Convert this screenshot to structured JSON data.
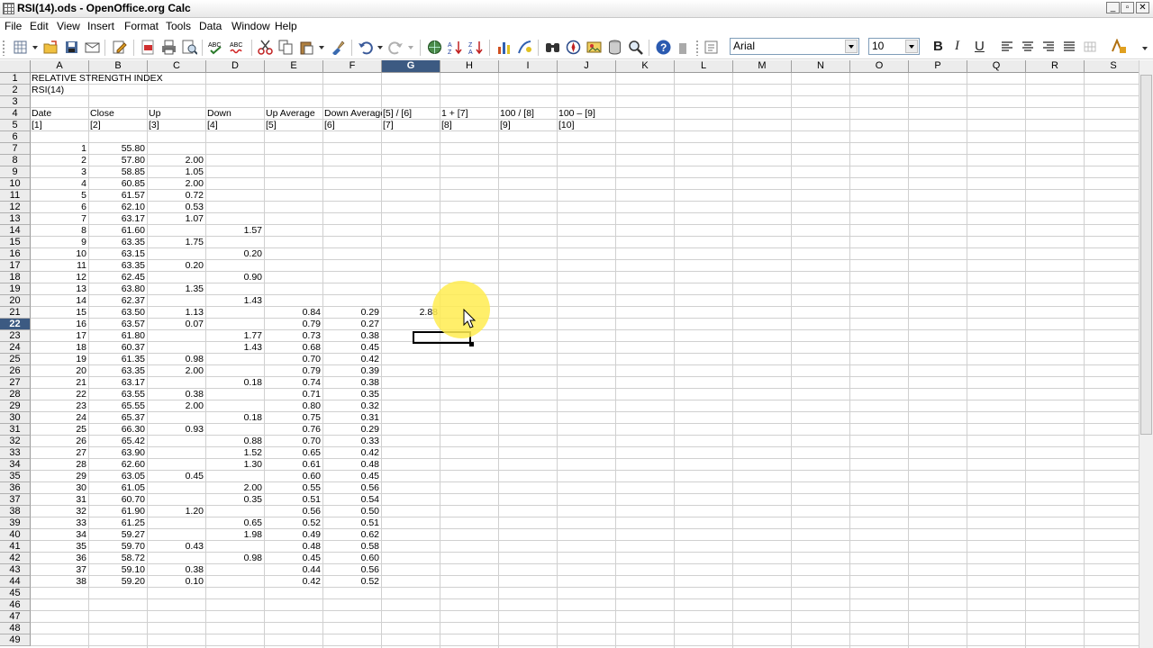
{
  "window": {
    "title": "RSI(14).ods - OpenOffice.org Calc",
    "controls": [
      "_",
      "▫",
      "✕"
    ]
  },
  "menu": [
    "File",
    "Edit",
    "View",
    "Insert",
    "Format",
    "Tools",
    "Data",
    "Window",
    "Help"
  ],
  "toolbar": {
    "font_name": "Arial",
    "font_size": "10",
    "bold": "B",
    "italic": "I",
    "underline": "U",
    "icons": [
      "new-icon",
      "open-icon",
      "save-icon",
      "email-icon",
      "edit-file-icon",
      "export-pdf-icon",
      "print-icon",
      "page-preview-icon",
      "spellcheck-icon",
      "autospell-icon",
      "cut-icon",
      "copy-icon",
      "paste-icon",
      "format-paintbrush-icon",
      "undo-icon",
      "redo-icon",
      "hyperlink-icon",
      "sort-ascending-icon",
      "sort-descending-icon",
      "chart-icon",
      "show-draw-functions-icon",
      "find-icon",
      "navigator-icon",
      "gallery-icon",
      "data-sources-icon",
      "zoom-icon",
      "help-icon"
    ]
  },
  "spreadsheet": {
    "selected_cell": "G22",
    "columns": [
      "A",
      "B",
      "C",
      "D",
      "E",
      "F",
      "G",
      "H",
      "I",
      "J",
      "K",
      "L",
      "M",
      "N",
      "O",
      "P",
      "Q",
      "R",
      "S"
    ],
    "rows": [
      "1",
      "2",
      "3",
      "4",
      "5",
      "6",
      "7",
      "8",
      "9",
      "10",
      "11",
      "12",
      "13",
      "14",
      "15",
      "16",
      "17",
      "18",
      "19",
      "20",
      "21",
      "22",
      "23",
      "24",
      "25",
      "26",
      "27",
      "28",
      "29",
      "30",
      "31",
      "32",
      "33",
      "34",
      "35",
      "36",
      "37",
      "38",
      "39",
      "40",
      "41",
      "42",
      "43",
      "44",
      "45",
      "46",
      "47",
      "48",
      "49"
    ],
    "title_rows": [
      {
        "row": 1,
        "col": 0,
        "text": "RELATIVE STRENGTH INDEX"
      },
      {
        "row": 2,
        "col": 0,
        "text": "RSI(14)"
      }
    ],
    "headers": [
      "Date",
      "Close",
      "Up",
      "Down",
      "Up Average",
      "Down Average",
      "[5] / [6]",
      "1 + [7]",
      "100 / [8]",
      "100 – [9]"
    ],
    "header_refs": [
      "[1]",
      "[2]",
      "[3]",
      "[4]",
      "[5]",
      "[6]",
      "[7]",
      "[8]",
      "[9]",
      "[10]"
    ],
    "data_rows": [
      {
        "date": "1",
        "close": "55.80",
        "up": "",
        "down": "",
        "up_avg": "",
        "down_avg": "",
        "g": ""
      },
      {
        "date": "2",
        "close": "57.80",
        "up": "2.00",
        "down": "",
        "up_avg": "",
        "down_avg": "",
        "g": ""
      },
      {
        "date": "3",
        "close": "58.85",
        "up": "1.05",
        "down": "",
        "up_avg": "",
        "down_avg": "",
        "g": ""
      },
      {
        "date": "4",
        "close": "60.85",
        "up": "2.00",
        "down": "",
        "up_avg": "",
        "down_avg": "",
        "g": ""
      },
      {
        "date": "5",
        "close": "61.57",
        "up": "0.72",
        "down": "",
        "up_avg": "",
        "down_avg": "",
        "g": ""
      },
      {
        "date": "6",
        "close": "62.10",
        "up": "0.53",
        "down": "",
        "up_avg": "",
        "down_avg": "",
        "g": ""
      },
      {
        "date": "7",
        "close": "63.17",
        "up": "1.07",
        "down": "",
        "up_avg": "",
        "down_avg": "",
        "g": ""
      },
      {
        "date": "8",
        "close": "61.60",
        "up": "",
        "down": "1.57",
        "up_avg": "",
        "down_avg": "",
        "g": ""
      },
      {
        "date": "9",
        "close": "63.35",
        "up": "1.75",
        "down": "",
        "up_avg": "",
        "down_avg": "",
        "g": ""
      },
      {
        "date": "10",
        "close": "63.15",
        "up": "",
        "down": "0.20",
        "up_avg": "",
        "down_avg": "",
        "g": ""
      },
      {
        "date": "11",
        "close": "63.35",
        "up": "0.20",
        "down": "",
        "up_avg": "",
        "down_avg": "",
        "g": ""
      },
      {
        "date": "12",
        "close": "62.45",
        "up": "",
        "down": "0.90",
        "up_avg": "",
        "down_avg": "",
        "g": ""
      },
      {
        "date": "13",
        "close": "63.80",
        "up": "1.35",
        "down": "",
        "up_avg": "",
        "down_avg": "",
        "g": ""
      },
      {
        "date": "14",
        "close": "62.37",
        "up": "",
        "down": "1.43",
        "up_avg": "",
        "down_avg": "",
        "g": ""
      },
      {
        "date": "15",
        "close": "63.50",
        "up": "1.13",
        "down": "",
        "up_avg": "0.84",
        "down_avg": "0.29",
        "g": "2.88"
      },
      {
        "date": "16",
        "close": "63.57",
        "up": "0.07",
        "down": "",
        "up_avg": "0.79",
        "down_avg": "0.27",
        "g": ""
      },
      {
        "date": "17",
        "close": "61.80",
        "up": "",
        "down": "1.77",
        "up_avg": "0.73",
        "down_avg": "0.38",
        "g": ""
      },
      {
        "date": "18",
        "close": "60.37",
        "up": "",
        "down": "1.43",
        "up_avg": "0.68",
        "down_avg": "0.45",
        "g": ""
      },
      {
        "date": "19",
        "close": "61.35",
        "up": "0.98",
        "down": "",
        "up_avg": "0.70",
        "down_avg": "0.42",
        "g": ""
      },
      {
        "date": "20",
        "close": "63.35",
        "up": "2.00",
        "down": "",
        "up_avg": "0.79",
        "down_avg": "0.39",
        "g": ""
      },
      {
        "date": "21",
        "close": "63.17",
        "up": "",
        "down": "0.18",
        "up_avg": "0.74",
        "down_avg": "0.38",
        "g": ""
      },
      {
        "date": "22",
        "close": "63.55",
        "up": "0.38",
        "down": "",
        "up_avg": "0.71",
        "down_avg": "0.35",
        "g": ""
      },
      {
        "date": "23",
        "close": "65.55",
        "up": "2.00",
        "down": "",
        "up_avg": "0.80",
        "down_avg": "0.32",
        "g": ""
      },
      {
        "date": "24",
        "close": "65.37",
        "up": "",
        "down": "0.18",
        "up_avg": "0.75",
        "down_avg": "0.31",
        "g": ""
      },
      {
        "date": "25",
        "close": "66.30",
        "up": "0.93",
        "down": "",
        "up_avg": "0.76",
        "down_avg": "0.29",
        "g": ""
      },
      {
        "date": "26",
        "close": "65.42",
        "up": "",
        "down": "0.88",
        "up_avg": "0.70",
        "down_avg": "0.33",
        "g": ""
      },
      {
        "date": "27",
        "close": "63.90",
        "up": "",
        "down": "1.52",
        "up_avg": "0.65",
        "down_avg": "0.42",
        "g": ""
      },
      {
        "date": "28",
        "close": "62.60",
        "up": "",
        "down": "1.30",
        "up_avg": "0.61",
        "down_avg": "0.48",
        "g": ""
      },
      {
        "date": "29",
        "close": "63.05",
        "up": "0.45",
        "down": "",
        "up_avg": "0.60",
        "down_avg": "0.45",
        "g": ""
      },
      {
        "date": "30",
        "close": "61.05",
        "up": "",
        "down": "2.00",
        "up_avg": "0.55",
        "down_avg": "0.56",
        "g": ""
      },
      {
        "date": "31",
        "close": "60.70",
        "up": "",
        "down": "0.35",
        "up_avg": "0.51",
        "down_avg": "0.54",
        "g": ""
      },
      {
        "date": "32",
        "close": "61.90",
        "up": "1.20",
        "down": "",
        "up_avg": "0.56",
        "down_avg": "0.50",
        "g": ""
      },
      {
        "date": "33",
        "close": "61.25",
        "up": "",
        "down": "0.65",
        "up_avg": "0.52",
        "down_avg": "0.51",
        "g": ""
      },
      {
        "date": "34",
        "close": "59.27",
        "up": "",
        "down": "1.98",
        "up_avg": "0.49",
        "down_avg": "0.62",
        "g": ""
      },
      {
        "date": "35",
        "close": "59.70",
        "up": "0.43",
        "down": "",
        "up_avg": "0.48",
        "down_avg": "0.58",
        "g": ""
      },
      {
        "date": "36",
        "close": "58.72",
        "up": "",
        "down": "0.98",
        "up_avg": "0.45",
        "down_avg": "0.60",
        "g": ""
      },
      {
        "date": "37",
        "close": "59.10",
        "up": "0.38",
        "down": "",
        "up_avg": "0.44",
        "down_avg": "0.56",
        "g": ""
      },
      {
        "date": "38",
        "close": "59.20",
        "up": "0.10",
        "down": "",
        "up_avg": "0.42",
        "down_avg": "0.52",
        "g": ""
      }
    ]
  },
  "colors": {
    "header_bg": "#ececec",
    "selected_header": "#3c5a82",
    "grid_line": "#d0d0d0",
    "highlight": "#ffec50"
  }
}
